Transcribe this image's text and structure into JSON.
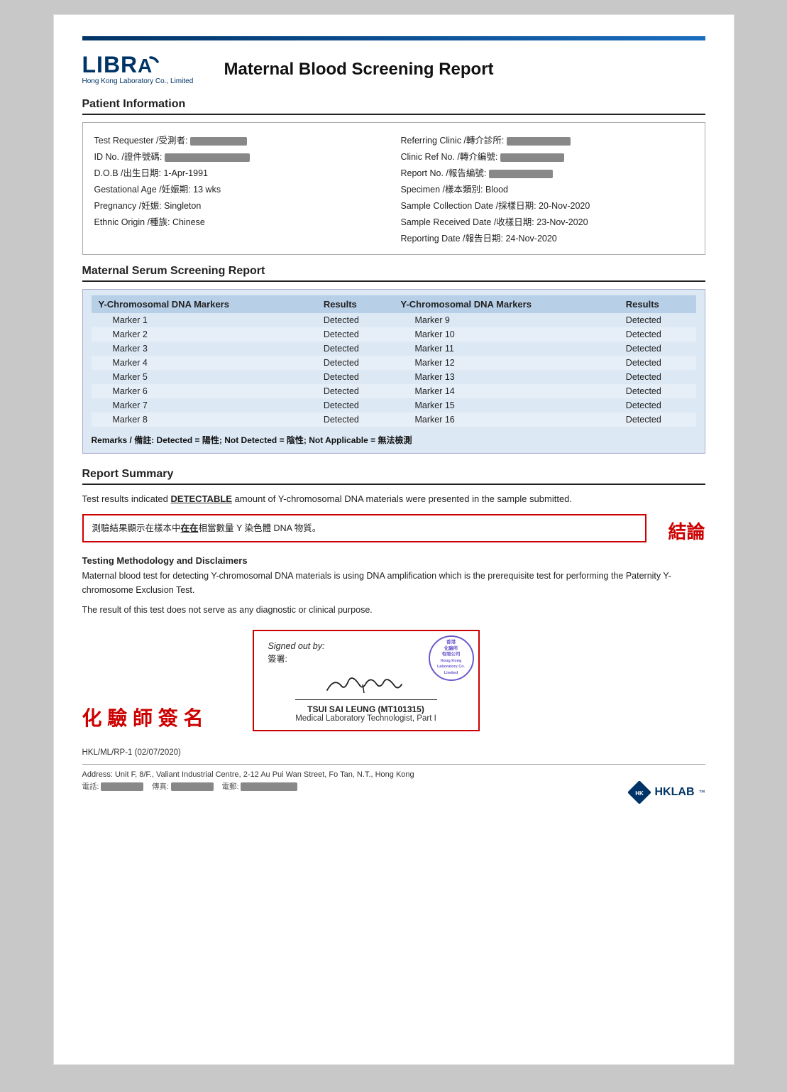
{
  "header": {
    "logo_text": "LIBRA",
    "logo_subtext": "Hong Kong Laboratory Co., Limited",
    "report_title": "Maternal Blood Screening Report"
  },
  "patient_section_title": "Patient Information",
  "patient": {
    "test_requester_label": "Test Requester /受測者:",
    "test_requester_value": "",
    "id_no_label": "ID No. /證件號碼:",
    "id_no_value": "",
    "dob_label": "D.O.B /出生日期:",
    "dob_value": "1-Apr-1991",
    "gestational_age_label": "Gestational Age /妊娠期:",
    "gestational_age_value": "13 wks",
    "pregnancy_label": "Pregnancy /妊娠:",
    "pregnancy_value": "Singleton",
    "ethnic_origin_label": "Ethnic Origin /種族:",
    "ethnic_origin_value": "Chinese",
    "referring_clinic_label": "Referring Clinic /轉介診所:",
    "referring_clinic_value": "",
    "clinic_ref_label": "Clinic Ref No. /轉介編號:",
    "clinic_ref_value": "",
    "report_no_label": "Report No. /報告編號:",
    "report_no_value": "",
    "specimen_label": "Specimen /樣本類別:",
    "specimen_value": "Blood",
    "sample_collection_label": "Sample Collection Date /採樣日期:",
    "sample_collection_value": "20-Nov-2020",
    "sample_received_label": "Sample Received Date /收樣日期:",
    "sample_received_value": "23-Nov-2020",
    "reporting_date_label": "Reporting Date /報告日期:",
    "reporting_date_value": "24-Nov-2020"
  },
  "screening_section_title": "Maternal Serum Screening Report",
  "table": {
    "col1_header": "Y-Chromosomal DNA Markers",
    "col2_header": "Results",
    "col3_header": "Y-Chromosomal DNA Markers",
    "col4_header": "Results",
    "rows": [
      {
        "marker_left": "Marker 1",
        "result_left": "Detected",
        "marker_right": "Marker 9",
        "result_right": "Detected"
      },
      {
        "marker_left": "Marker 2",
        "result_left": "Detected",
        "marker_right": "Marker 10",
        "result_right": "Detected"
      },
      {
        "marker_left": "Marker 3",
        "result_left": "Detected",
        "marker_right": "Marker 11",
        "result_right": "Detected"
      },
      {
        "marker_left": "Marker 4",
        "result_left": "Detected",
        "marker_right": "Marker 12",
        "result_right": "Detected"
      },
      {
        "marker_left": "Marker 5",
        "result_left": "Detected",
        "marker_right": "Marker 13",
        "result_right": "Detected"
      },
      {
        "marker_left": "Marker 6",
        "result_left": "Detected",
        "marker_right": "Marker 14",
        "result_right": "Detected"
      },
      {
        "marker_left": "Marker 7",
        "result_left": "Detected",
        "marker_right": "Marker 15",
        "result_right": "Detected"
      },
      {
        "marker_left": "Marker 8",
        "result_left": "Detected",
        "marker_right": "Marker 16",
        "result_right": "Detected"
      }
    ],
    "remarks": "Remarks / 備註: Detected = 陽性; Not Detected = 陰性; Not Applicable = 無法檢測"
  },
  "report_summary": {
    "section_title": "Report Summary",
    "summary_line1": "Test results indicated ",
    "detectable_word": "DETECTABLE",
    "summary_line2": " amount of Y-chromosomal DNA materials were presented in the sample submitted.",
    "chinese_line": "測驗結果顯示在樣本中",
    "chinese_underline": "在在",
    "chinese_line2": "相當數量 Y 染色體 DNA 物質。",
    "conclusion_label": "結論"
  },
  "methodology": {
    "title": "Testing Methodology and Disclaimers",
    "text1": "Maternal blood test for detecting Y-chromosomal DNA materials is using DNA amplification which is the prerequisite test for performing the Paternity Y-chromosome Exclusion Test.",
    "text2": "The result of this test does not serve as any diagnostic or clinical purpose."
  },
  "signature": {
    "left_label": "化 驗 師 簽 名",
    "signed_out_label": "Signed out by:",
    "signed_chinese": "簽署:",
    "stamp_text": "香港\n化驗所\n有限公司\nHong Kong\nLaboratory Co.\nLimited",
    "signer_name": "TSUI SAI LEUNG (MT101315)",
    "signer_title": "Medical Laboratory Technologist, Part I"
  },
  "footer": {
    "doc_code": "HKL/ML/RP-1 (02/07/2020)",
    "address": "Address: Unit F, 8/F., Valiant Industrial Centre, 2-12 Au Pui Wan Street, Fo Tan, N.T., Hong Kong",
    "contact": "電話: ██████████    傳真: ██████████    電郵: ████████████"
  }
}
